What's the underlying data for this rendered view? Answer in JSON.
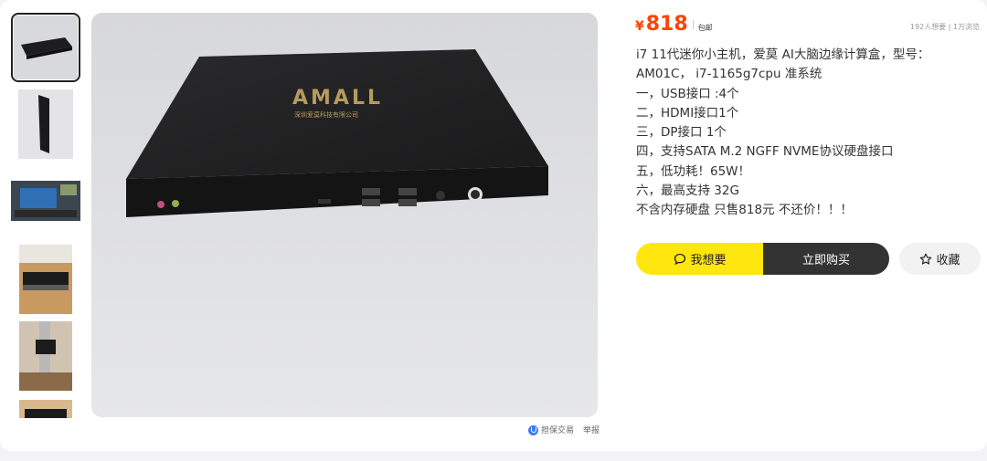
{
  "product": {
    "currency_symbol": "¥",
    "price": "818",
    "shipping": "包邮",
    "stats": "192人想要 | 1万浏览",
    "description_lines": [
      "i7 11代迷你小主机，爱莫 AI大脑边缘计算盒，型号：",
      "AM01C， i7-1165g7cpu 准系统",
      "一，USB接口 :4个",
      "二，HDMI接口1个",
      "三，DP接口 1个",
      "四，支持SATA M.2 NGFF NVME协议硬盘接口",
      "五，低功耗！65W！",
      "六，最高支持 32G",
      "不含内存硬盘 只售818元 不还价！！！"
    ],
    "image_brand_text": "AMALL",
    "image_sub_text": "深圳爱莫科技有限公司"
  },
  "actions": {
    "want_label": "我想要",
    "buy_label": "立即购买",
    "fav_label": "收藏"
  },
  "footer": {
    "guarantee_label": "担保交易",
    "report_label": "举报"
  },
  "colors": {
    "price": "#ff4400",
    "want_button": "#ffe60f",
    "buy_button": "#333333",
    "guarantee_icon": "#3a7bf6"
  },
  "icons": {
    "want": "chat-bubble-icon",
    "fav": "star-icon",
    "guarantee": "shield-icon"
  }
}
